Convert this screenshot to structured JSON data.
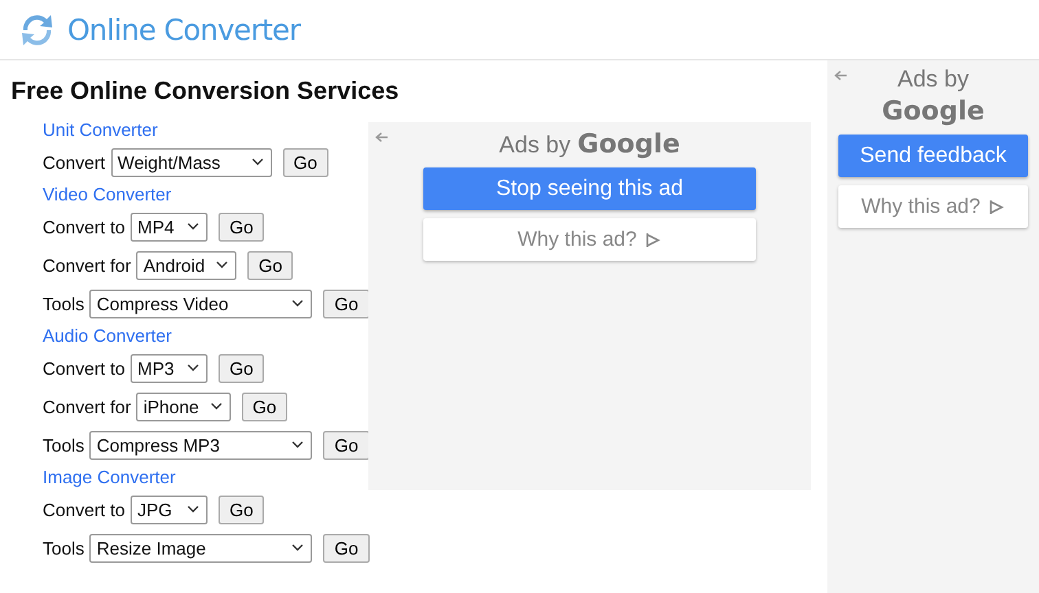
{
  "site": {
    "title": "Online Converter"
  },
  "heading": "Free Online Conversion Services",
  "sections": [
    {
      "title": "Unit Converter",
      "rows": [
        {
          "label": "Convert",
          "value": "Weight/Mass",
          "button": "Go"
        }
      ]
    },
    {
      "title": "Video Converter",
      "rows": [
        {
          "label": "Convert to",
          "value": "MP4",
          "button": "Go"
        },
        {
          "label": "Convert for",
          "value": "Android",
          "button": "Go"
        },
        {
          "label": "Tools",
          "value": "Compress Video",
          "button": "Go"
        }
      ]
    },
    {
      "title": "Audio Converter",
      "rows": [
        {
          "label": "Convert to",
          "value": "MP3",
          "button": "Go"
        },
        {
          "label": "Convert for",
          "value": "iPhone",
          "button": "Go"
        },
        {
          "label": "Tools",
          "value": "Compress MP3",
          "button": "Go"
        }
      ]
    },
    {
      "title": "Image Converter",
      "rows": [
        {
          "label": "Convert to",
          "value": "JPG",
          "button": "Go"
        },
        {
          "label": "Tools",
          "value": "Resize Image",
          "button": "Go"
        }
      ]
    }
  ],
  "ads": [
    {
      "kind": "inline",
      "prefix": "Ads by",
      "brand": "Google",
      "primary": "Stop seeing this ad",
      "secondary": "Why this ad?"
    },
    {
      "kind": "side",
      "prefix": "Ads by",
      "brand": "Google",
      "primary": "Send feedback",
      "secondary": "Why this ad?"
    }
  ]
}
